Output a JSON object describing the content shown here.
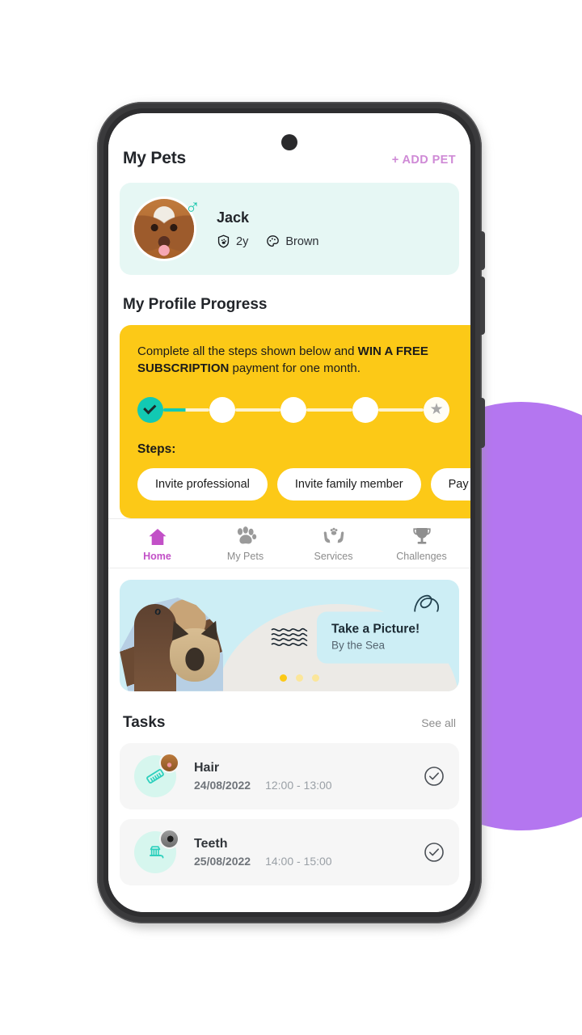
{
  "app": {
    "header": {
      "title": "My Pets",
      "add_pet_label": "+ ADD PET"
    },
    "pet_card": {
      "name": "Jack",
      "gender_icon": "male-symbol-icon",
      "age": "2y",
      "age_icon": "shield-paw-icon",
      "color": "Brown",
      "color_icon": "palette-icon",
      "avatar_icon": "dog-avatar"
    },
    "profile_progress": {
      "section_title": "My Profile Progress",
      "promo_prefix": "Complete all the steps shown below and ",
      "promo_bold": "WIN A FREE SUBSCRIPTION",
      "promo_suffix": " payment for one month.",
      "steps_label": "Steps:",
      "nodes": [
        {
          "state": "done",
          "icon": "check-icon"
        },
        {
          "state": "todo",
          "icon": ""
        },
        {
          "state": "todo",
          "icon": ""
        },
        {
          "state": "todo",
          "icon": ""
        },
        {
          "state": "reward",
          "icon": "star-icon"
        }
      ],
      "chips": [
        "Invite professional",
        "Invite family member",
        "Pay"
      ]
    },
    "nav": {
      "items": [
        {
          "label": "Home",
          "icon": "home-icon",
          "active": true
        },
        {
          "label": "My Pets",
          "icon": "paw-icon",
          "active": false
        },
        {
          "label": "Services",
          "icon": "hands-paw-icon",
          "active": false
        },
        {
          "label": "Challenges",
          "icon": "trophy-icon",
          "active": false
        }
      ]
    },
    "banner": {
      "title": "Take a Picture!",
      "subtitle": "By the Sea",
      "wave_icon": "wave-lines-icon",
      "loop_icon": "loop-doodle-icon",
      "spark_icon": "spark-icon",
      "dots": [
        true,
        false,
        false
      ]
    },
    "tasks": {
      "title": "Tasks",
      "see_all_label": "See all",
      "items": [
        {
          "name": "Hair",
          "date": "24/08/2022",
          "time": "12:00 - 13:00",
          "icon": "comb-icon",
          "pet": "dog",
          "check_icon": "check-circle-icon"
        },
        {
          "name": "Teeth",
          "date": "25/08/2022",
          "time": "14:00 - 15:00",
          "icon": "toothbrush-icon",
          "pet": "cat",
          "check_icon": "check-circle-icon"
        }
      ]
    }
  },
  "colors": {
    "accent_yellow": "#fcc917",
    "accent_teal": "#12c9b3",
    "accent_pink": "#c250c7",
    "add_pet_pink": "#cf8ad6",
    "pet_card_bg": "#e6f7f4",
    "banner_bg": "#cdeef5",
    "blob_purple": "#b476f0",
    "phone_frame": "#3a3a3c"
  }
}
